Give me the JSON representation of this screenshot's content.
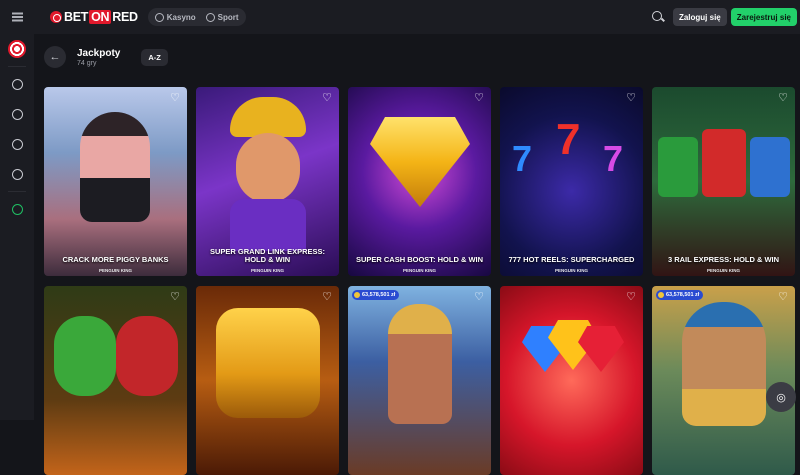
{
  "brand": {
    "logo_pre": "BET",
    "logo_on": "ON",
    "logo_post": "RED"
  },
  "top_nav": {
    "casino_label": "Kasyno",
    "sport_label": "Sport"
  },
  "auth": {
    "login_label": "Zaloguj się",
    "register_label": "Zarejestruj się"
  },
  "page": {
    "title": "Jackpoty",
    "count": "74 gry",
    "sort_label": "A-Z"
  },
  "sidebar": {
    "icons": [
      "darts-icon",
      "casino-chip-icon",
      "live-signal-icon",
      "football-icon",
      "horse-icon",
      "green-chip-icon"
    ]
  },
  "games": [
    {
      "name": "CRACK MORE PIGGY BANKS",
      "provider": "PENGUIN KING",
      "jackpot": ""
    },
    {
      "name": "SUPER GRAND LINK EXPRESS: HOLD & WIN",
      "provider": "PENGUIN KING",
      "jackpot": ""
    },
    {
      "name": "SUPER CASH BOOST: HOLD & WIN",
      "provider": "PENGUIN KING",
      "jackpot": ""
    },
    {
      "name": "777 HOT REELS: SUPERCHARGED",
      "provider": "PENGUIN KING",
      "jackpot": ""
    },
    {
      "name": "3 RAIL EXPRESS: HOLD & WIN",
      "provider": "PENGUIN KING",
      "jackpot": ""
    },
    {
      "name": "",
      "provider": "",
      "jackpot": ""
    },
    {
      "name": "",
      "provider": "",
      "jackpot": ""
    },
    {
      "name": "",
      "provider": "",
      "jackpot": "63,578,501 zł"
    },
    {
      "name": "",
      "provider": "",
      "jackpot": ""
    },
    {
      "name": "",
      "provider": "",
      "jackpot": "63,578,501 zł"
    }
  ],
  "colors": {
    "brand_red": "#e1192c",
    "register_green": "#22d06a",
    "jackpot_badge": "#2a4bd1"
  }
}
